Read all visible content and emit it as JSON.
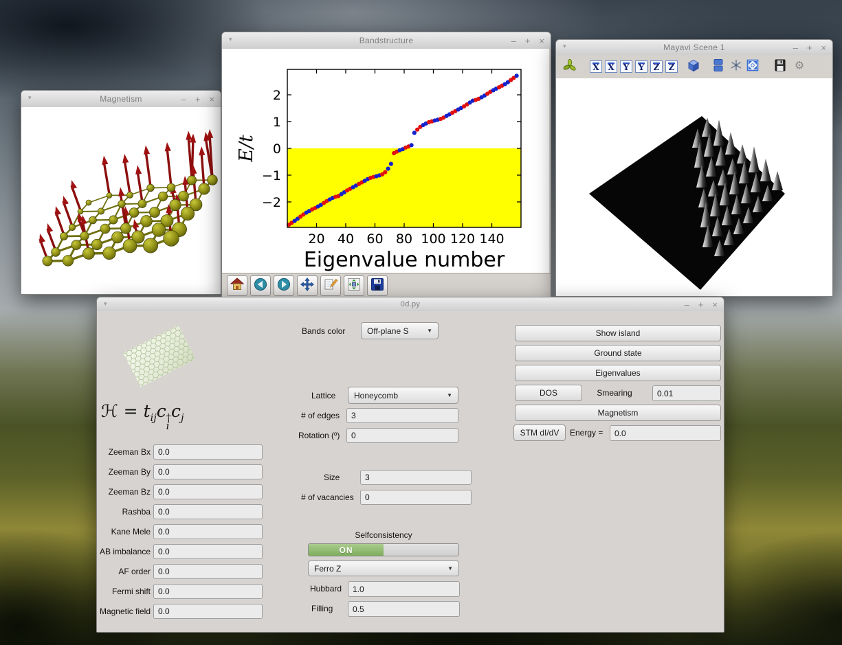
{
  "window_controls": {
    "shade": "▾",
    "min": "–",
    "max": "+",
    "close": "×"
  },
  "windows": {
    "magnetism": {
      "title": "Magnetism"
    },
    "bandstructure": {
      "title": "Bandstructure",
      "toolbar_icons": [
        "home",
        "back",
        "forward",
        "pan",
        "zoom",
        "configure-subplots",
        "save-figure"
      ]
    },
    "mayavi": {
      "title": "Mayavi Scene 1",
      "toolbar_icons": [
        {
          "name": "mayavi-logo-icon"
        },
        {
          "name": "view-x-plus-icon",
          "letter": "X"
        },
        {
          "name": "view-x-minus-icon",
          "letter": "X"
        },
        {
          "name": "view-y-plus-icon",
          "letter": "Y"
        },
        {
          "name": "view-y-minus-icon",
          "letter": "Y"
        },
        {
          "name": "view-z-plus-icon",
          "letter": "Z"
        },
        {
          "name": "view-z-minus-icon",
          "letter": "Z"
        },
        {
          "name": "isometric-view-icon"
        },
        {
          "name": "parallel-projection-icon"
        },
        {
          "name": "axes-indicator-icon"
        },
        {
          "name": "fullscreen-icon"
        },
        {
          "name": "save-scene-icon"
        },
        {
          "name": "configure-scene-icon"
        }
      ]
    },
    "main": {
      "title": "0d.py"
    }
  },
  "main": {
    "bands_color": {
      "label": "Bands color",
      "value": "Off-plane S"
    },
    "lattice": {
      "label": "Lattice",
      "value": "Honeycomb"
    },
    "edges": {
      "label": "# of edges",
      "value": "3"
    },
    "rotation": {
      "label": "Rotation (º)",
      "value": "0"
    },
    "size": {
      "label": "Size",
      "value": "3"
    },
    "vacancies": {
      "label": "# of vacancies",
      "value": "0"
    },
    "selfconsistency": {
      "label": "Selfconsistency",
      "toggle": "ON",
      "mode": "Ferro Z"
    },
    "hubbard": {
      "label": "Hubbard",
      "value": "1.0"
    },
    "filling": {
      "label": "Filling",
      "value": "0.5"
    },
    "fields": [
      {
        "label": "Zeeman Bx",
        "value": "0.0"
      },
      {
        "label": "Zeeman By",
        "value": "0.0"
      },
      {
        "label": "Zeeman Bz",
        "value": "0.0"
      },
      {
        "label": "Rashba",
        "value": "0.0"
      },
      {
        "label": "Kane Mele",
        "value": "0.0"
      },
      {
        "label": "AB imbalance",
        "value": "0.0"
      },
      {
        "label": "AF order",
        "value": "0.0"
      },
      {
        "label": "Fermi shift",
        "value": "0.0"
      },
      {
        "label": "Magnetic field",
        "value": "0.0"
      }
    ],
    "buttons": {
      "show_island": "Show island",
      "ground_state": "Ground state",
      "eigenvalues": "Eigenvalues",
      "dos": "DOS",
      "smearing_label": "Smearing",
      "smearing_value": "0.01",
      "magnetism": "Magnetism",
      "stm": "STM dI/dV",
      "energy_label": "Energy =",
      "energy_value": "0.0"
    },
    "hamiltonian": {
      "h": "ℋ",
      "eq": " = ",
      "t": "t",
      "t_sub": "ij",
      "c": "c",
      "dagger": "†",
      "i_sub": "i",
      "j_sub": "j"
    }
  },
  "chart_data": {
    "type": "scatter",
    "title": "",
    "xlabel": "Eigenvalue number",
    "ylabel": "E/t",
    "xlim": [
      0,
      160
    ],
    "ylim": [
      -2.95,
      2.95
    ],
    "xticks": [
      20,
      40,
      60,
      80,
      100,
      120,
      140
    ],
    "yticks": [
      -2,
      -1,
      0,
      1,
      2
    ],
    "grid": false,
    "fill_below": {
      "y": 0,
      "color": "#ffff00"
    },
    "colors": {
      "r": "#e01010",
      "b": "#1522cc"
    },
    "points": [
      [
        1,
        -2.85,
        "r"
      ],
      [
        3,
        -2.78,
        "r"
      ],
      [
        5,
        -2.71,
        "b"
      ],
      [
        7,
        -2.63,
        "b"
      ],
      [
        9,
        -2.55,
        "r"
      ],
      [
        11,
        -2.47,
        "r"
      ],
      [
        13,
        -2.4,
        "b"
      ],
      [
        15,
        -2.34,
        "b"
      ],
      [
        17,
        -2.28,
        "r"
      ],
      [
        19,
        -2.23,
        "r"
      ],
      [
        21,
        -2.17,
        "b"
      ],
      [
        23,
        -2.11,
        "b"
      ],
      [
        25,
        -2.04,
        "r"
      ],
      [
        27,
        -1.97,
        "r"
      ],
      [
        29,
        -1.91,
        "b"
      ],
      [
        31,
        -1.85,
        "b"
      ],
      [
        33,
        -1.81,
        "r"
      ],
      [
        35,
        -1.78,
        "r"
      ],
      [
        37,
        -1.71,
        "b"
      ],
      [
        39,
        -1.64,
        "b"
      ],
      [
        41,
        -1.57,
        "r"
      ],
      [
        43,
        -1.51,
        "r"
      ],
      [
        45,
        -1.45,
        "b"
      ],
      [
        47,
        -1.39,
        "b"
      ],
      [
        49,
        -1.33,
        "r"
      ],
      [
        51,
        -1.27,
        "r"
      ],
      [
        53,
        -1.21,
        "b"
      ],
      [
        55,
        -1.15,
        "b"
      ],
      [
        57,
        -1.1,
        "r"
      ],
      [
        59,
        -1.07,
        "r"
      ],
      [
        61,
        -1.04,
        "b"
      ],
      [
        63,
        -1.01,
        "b"
      ],
      [
        65,
        -0.97,
        "r"
      ],
      [
        67,
        -0.89,
        "r"
      ],
      [
        69,
        -0.76,
        "b"
      ],
      [
        71,
        -0.58,
        "b"
      ],
      [
        73,
        -0.18,
        "r"
      ],
      [
        75,
        -0.12,
        "r"
      ],
      [
        77,
        -0.07,
        "b"
      ],
      [
        79,
        -0.03,
        "b"
      ],
      [
        81,
        0.03,
        "r"
      ],
      [
        83,
        0.07,
        "r"
      ],
      [
        85,
        0.12,
        "b"
      ],
      [
        87,
        0.58,
        "b"
      ],
      [
        89,
        0.7,
        "r"
      ],
      [
        91,
        0.8,
        "r"
      ],
      [
        93,
        0.87,
        "b"
      ],
      [
        95,
        0.93,
        "b"
      ],
      [
        97,
        0.98,
        "r"
      ],
      [
        99,
        1.01,
        "r"
      ],
      [
        101,
        1.04,
        "b"
      ],
      [
        103,
        1.07,
        "b"
      ],
      [
        105,
        1.1,
        "r"
      ],
      [
        107,
        1.15,
        "r"
      ],
      [
        109,
        1.21,
        "b"
      ],
      [
        111,
        1.27,
        "b"
      ],
      [
        113,
        1.33,
        "r"
      ],
      [
        115,
        1.39,
        "r"
      ],
      [
        117,
        1.45,
        "b"
      ],
      [
        119,
        1.51,
        "b"
      ],
      [
        121,
        1.57,
        "r"
      ],
      [
        123,
        1.64,
        "r"
      ],
      [
        125,
        1.71,
        "b"
      ],
      [
        127,
        1.78,
        "b"
      ],
      [
        129,
        1.81,
        "r"
      ],
      [
        131,
        1.85,
        "r"
      ],
      [
        133,
        1.91,
        "b"
      ],
      [
        135,
        1.97,
        "b"
      ],
      [
        137,
        2.04,
        "r"
      ],
      [
        139,
        2.11,
        "r"
      ],
      [
        141,
        2.17,
        "b"
      ],
      [
        143,
        2.23,
        "b"
      ],
      [
        145,
        2.28,
        "r"
      ],
      [
        147,
        2.34,
        "r"
      ],
      [
        149,
        2.4,
        "b"
      ],
      [
        151,
        2.47,
        "b"
      ],
      [
        153,
        2.55,
        "r"
      ],
      [
        155,
        2.63,
        "r"
      ],
      [
        157,
        2.71,
        "b"
      ]
    ]
  }
}
